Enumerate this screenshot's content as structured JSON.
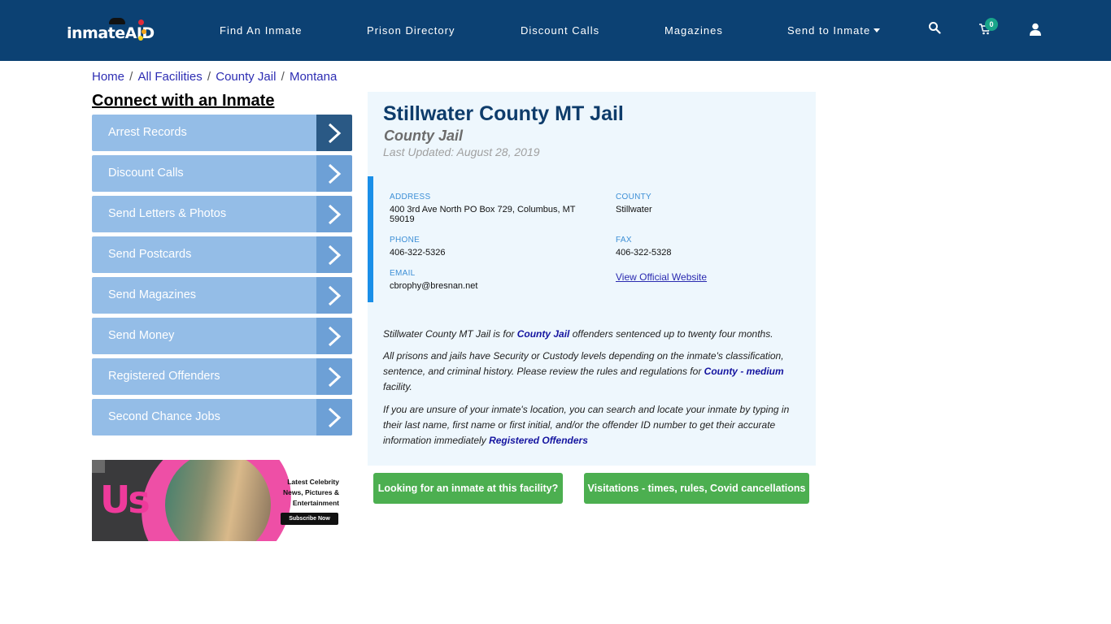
{
  "header": {
    "logo_text": "inmateAID",
    "nav": [
      {
        "label": "Find An Inmate"
      },
      {
        "label": "Prison Directory"
      },
      {
        "label": "Discount Calls"
      },
      {
        "label": "Magazines"
      },
      {
        "label": "Send to Inmate",
        "has_dropdown": true
      }
    ],
    "icons": {
      "search": "search-icon",
      "cart": "cart-icon",
      "user": "user-icon"
    },
    "cart_count": "0"
  },
  "breadcrumb": [
    {
      "label": "Home"
    },
    {
      "label": "All Facilities"
    },
    {
      "label": "County Jail"
    },
    {
      "label": "Montana"
    }
  ],
  "sidebar": {
    "title": "Connect with an Inmate",
    "items": [
      {
        "label": "Arrest Records",
        "active": true
      },
      {
        "label": "Discount Calls"
      },
      {
        "label": "Send Letters & Photos"
      },
      {
        "label": "Send Postcards"
      },
      {
        "label": "Send Magazines"
      },
      {
        "label": "Send Money"
      },
      {
        "label": "Registered Offenders"
      },
      {
        "label": "Second Chance Jobs"
      }
    ]
  },
  "ad": {
    "brand": "Us",
    "text": "Latest Celebrity News, Pictures & Entertainment",
    "button": "Subscribe Now"
  },
  "facility": {
    "name": "Stillwater County MT Jail",
    "type": "County Jail",
    "last_updated": "Last Updated: August 28, 2019",
    "address_label": "ADDRESS",
    "address": "400 3rd Ave North PO Box 729, Columbus, MT 59019",
    "county_label": "COUNTY",
    "county": "Stillwater",
    "phone_label": "PHONE",
    "phone": "406-322-5326",
    "fax_label": "FAX",
    "fax": "406-322-5328",
    "email_label": "EMAIL",
    "email": "cbrophy@bresnan.net",
    "website_link": "View Official Website"
  },
  "description": {
    "p1_pre": "Stillwater County MT Jail is for ",
    "p1_link": "County Jail",
    "p1_post": " offenders sentenced up to twenty four months.",
    "p2_pre": "All prisons and jails have Security or Custody levels depending on the inmate's classification, sentence, and criminal history. Please review the rules and regulations for ",
    "p2_link": "County - medium",
    "p2_post": " facility.",
    "p3_pre": "If you are unsure of your inmate's location, you can search and locate your inmate by typing in their last name, first name or first initial, and/or the offender ID number to get their accurate information immediately ",
    "p3_link": "Registered Offenders"
  },
  "buttons": {
    "find_inmate": "Looking for an inmate at this facility?",
    "visitations": "Visitations - times, rules, Covid cancellations"
  },
  "colors": {
    "header_bg": "#0c4173",
    "side_item_bg": "#94bde7",
    "side_arrow_bg": "#6da0d6",
    "side_arrow_active": "#2a5985",
    "panel_bg": "#eef7fd",
    "info_accent": "#1a8fe8",
    "green_button": "#4caf50",
    "title_color": "#0e3c6b"
  }
}
